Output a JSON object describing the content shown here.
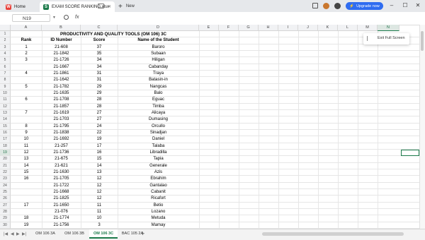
{
  "tabs": {
    "home": "Home",
    "file": "EXAM SCORE RANKING.xlsx",
    "new": "New"
  },
  "toolbar": {
    "upgrade": "Upgrade now"
  },
  "formula": {
    "name_box": "N19",
    "fx": "fx"
  },
  "columns": [
    "A",
    "B",
    "C",
    "D",
    "E",
    "F",
    "G",
    "H",
    "I",
    "J",
    "K",
    "L",
    "M",
    "N"
  ],
  "title": "PRODUCTIVITY AND QUALITY TOOLS (OM 106) 3C",
  "headers": {
    "rank": "Rank",
    "id": "ID Number",
    "score": "Score",
    "name": "Name of the Student"
  },
  "rows": [
    {
      "rank": "1",
      "id": "21-608",
      "score": "37",
      "name": "Baroro"
    },
    {
      "rank": "2",
      "id": "21-1842",
      "score": "35",
      "name": "Subaan"
    },
    {
      "rank": "3",
      "id": "21-1726",
      "score": "34",
      "name": "Hiligan"
    },
    {
      "rank": "",
      "id": "21-1667",
      "score": "34",
      "name": "Cabanday"
    },
    {
      "rank": "4",
      "id": "21-1861",
      "score": "31",
      "name": "Traya"
    },
    {
      "rank": "",
      "id": "21-1642",
      "score": "31",
      "name": "Batasin-in"
    },
    {
      "rank": "5",
      "id": "21-1782",
      "score": "29",
      "name": "Nangcas"
    },
    {
      "rank": "",
      "id": "21-1635",
      "score": "29",
      "name": "Balo"
    },
    {
      "rank": "6",
      "id": "21-1708",
      "score": "28",
      "name": "Eguac"
    },
    {
      "rank": "",
      "id": "21-1857",
      "score": "28",
      "name": "Timba"
    },
    {
      "rank": "7",
      "id": "21-1619",
      "score": "27",
      "name": "Alicaya"
    },
    {
      "rank": "",
      "id": "21-1703",
      "score": "27",
      "name": "Dumasing"
    },
    {
      "rank": "8",
      "id": "21-1795",
      "score": "24",
      "name": "Orcullo"
    },
    {
      "rank": "9",
      "id": "21-1838",
      "score": "22",
      "name": "Sinadjan"
    },
    {
      "rank": "10",
      "id": "21-1692",
      "score": "19",
      "name": "Daniel"
    },
    {
      "rank": "11",
      "id": "21-257",
      "score": "17",
      "name": "Talaba"
    },
    {
      "rank": "12",
      "id": "21-1736",
      "score": "16",
      "name": "Libradilla"
    },
    {
      "rank": "13",
      "id": "21-675",
      "score": "15",
      "name": "Tapia"
    },
    {
      "rank": "14",
      "id": "21-621",
      "score": "14",
      "name": "Generale"
    },
    {
      "rank": "15",
      "id": "21-1630",
      "score": "13",
      "name": "Azis"
    },
    {
      "rank": "16",
      "id": "21-1705",
      "score": "12",
      "name": "Ebrahim"
    },
    {
      "rank": "",
      "id": "21-1722",
      "score": "12",
      "name": "Gantalao"
    },
    {
      "rank": "",
      "id": "21-1668",
      "score": "12",
      "name": "Cabanit"
    },
    {
      "rank": "",
      "id": "21-1825",
      "score": "12",
      "name": "Ricafort"
    },
    {
      "rank": "17",
      "id": "21-1650",
      "score": "11",
      "name": "Betio"
    },
    {
      "rank": "",
      "id": "21-076",
      "score": "11",
      "name": "Lozano"
    },
    {
      "rank": "18",
      "id": "21-1774",
      "score": "10",
      "name": "Metuda"
    },
    {
      "rank": "19",
      "id": "21-1756",
      "score": "3",
      "name": "Mamay"
    }
  ],
  "popup": {
    "exit_full_screen": "Exit Full Screen"
  },
  "sheets": [
    "OM 106 3A",
    "OM 106 3B",
    "OM 106 3C",
    "BAC 105 2A"
  ],
  "active_sheet": "OM 106 3C",
  "colors": {
    "accent": "#1b7a4a",
    "upgrade": "#2f6cf0"
  }
}
